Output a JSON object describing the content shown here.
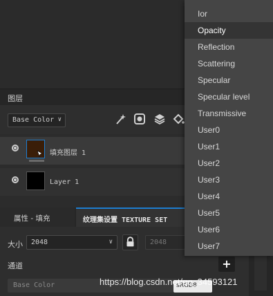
{
  "layers_panel": {
    "title": "图层",
    "channel_select": "Base Color",
    "layers": [
      {
        "name": "填充图层 1",
        "thumb_color": "#3a1e08",
        "selected": true
      },
      {
        "name": "Layer 1",
        "thumb_color": "#000000",
        "selected": false
      }
    ]
  },
  "properties": {
    "tabs": [
      "属性 - 填充",
      "纹理集设置 TEXTURE SET"
    ],
    "size_label": "大小",
    "size_value": "2048",
    "size_value_locked": "2048",
    "channels_label": "通道",
    "add_label": "+",
    "channel_name": "Base Color",
    "channel_format": "sRGB8"
  },
  "dropdown_menu": {
    "items": [
      "Ior",
      "Opacity",
      "Reflection",
      "Scattering",
      "Specular",
      "Specular level",
      "Transmissive",
      "User0",
      "User1",
      "User2",
      "User3",
      "User4",
      "User5",
      "User6",
      "User7"
    ],
    "highlighted_index": 1
  },
  "watermark": "https://blog.csdn.net/qq_34593121",
  "colors": {
    "accent": "#1d7ed1",
    "menu_bg": "#454545",
    "menu_highlight": "#343434"
  }
}
